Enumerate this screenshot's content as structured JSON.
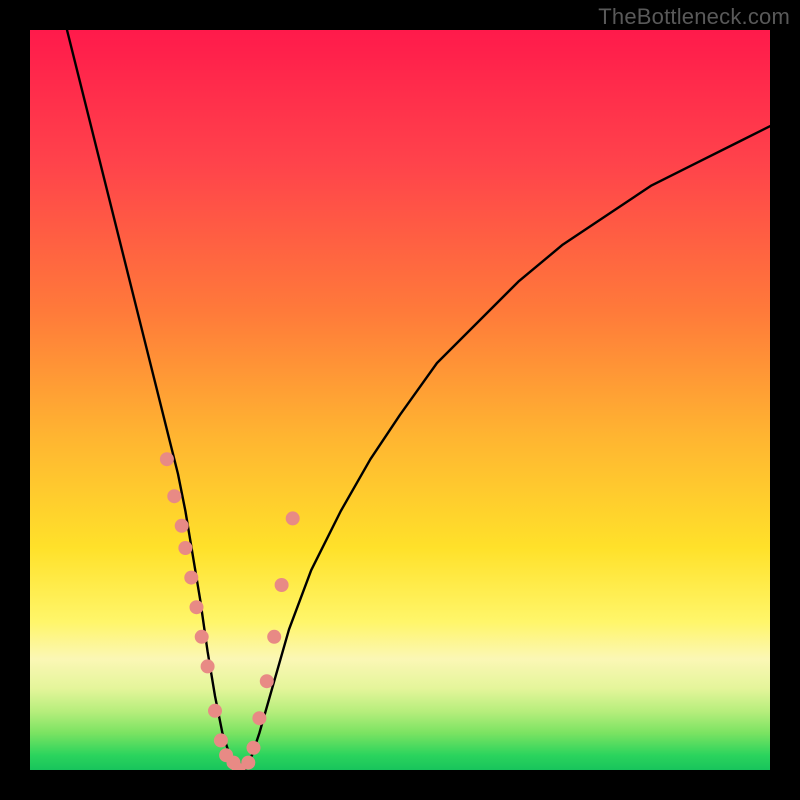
{
  "watermark": "TheBottleneck.com",
  "chart_data": {
    "type": "line",
    "title": "",
    "xlabel": "",
    "ylabel": "",
    "xlim": [
      0,
      100
    ],
    "ylim": [
      0,
      100
    ],
    "grid": false,
    "legend": false,
    "gradient_stops": [
      {
        "offset": 0,
        "color": "#ff1a4b"
      },
      {
        "offset": 18,
        "color": "#ff434b"
      },
      {
        "offset": 38,
        "color": "#ff7a3a"
      },
      {
        "offset": 55,
        "color": "#ffb531"
      },
      {
        "offset": 70,
        "color": "#ffe12a"
      },
      {
        "offset": 80,
        "color": "#fff66a"
      },
      {
        "offset": 85,
        "color": "#fbf7b5"
      },
      {
        "offset": 89,
        "color": "#e4f59a"
      },
      {
        "offset": 92,
        "color": "#b8ee7d"
      },
      {
        "offset": 95,
        "color": "#7be362"
      },
      {
        "offset": 98,
        "color": "#2bd45d"
      },
      {
        "offset": 100,
        "color": "#18c45c"
      }
    ],
    "series": [
      {
        "name": "bottleneck-curve",
        "color": "#000000",
        "x": [
          5,
          7,
          9,
          11,
          13,
          15,
          17,
          19,
          20,
          21,
          22,
          23,
          24,
          25,
          26,
          27,
          28,
          29,
          30,
          31,
          33,
          35,
          38,
          42,
          46,
          50,
          55,
          60,
          66,
          72,
          78,
          84,
          90,
          96,
          100
        ],
        "y": [
          100,
          92,
          84,
          76,
          68,
          60,
          52,
          44,
          40,
          35,
          29,
          23,
          16,
          10,
          5,
          2,
          0,
          0,
          2,
          5,
          12,
          19,
          27,
          35,
          42,
          48,
          55,
          60,
          66,
          71,
          75,
          79,
          82,
          85,
          87
        ]
      }
    ],
    "markers": {
      "name": "sample-points",
      "color": "#e88a85",
      "radius_px": 7,
      "x": [
        18.5,
        19.5,
        20.5,
        21.0,
        21.8,
        22.5,
        23.2,
        24.0,
        25.0,
        25.8,
        26.5,
        27.5,
        28.2,
        29.5,
        30.2,
        31.0,
        32.0,
        33.0,
        34.0,
        35.5
      ],
      "y": [
        42,
        37,
        33,
        30,
        26,
        22,
        18,
        14,
        8,
        4,
        2,
        1,
        0,
        1,
        3,
        7,
        12,
        18,
        25,
        34
      ]
    }
  }
}
